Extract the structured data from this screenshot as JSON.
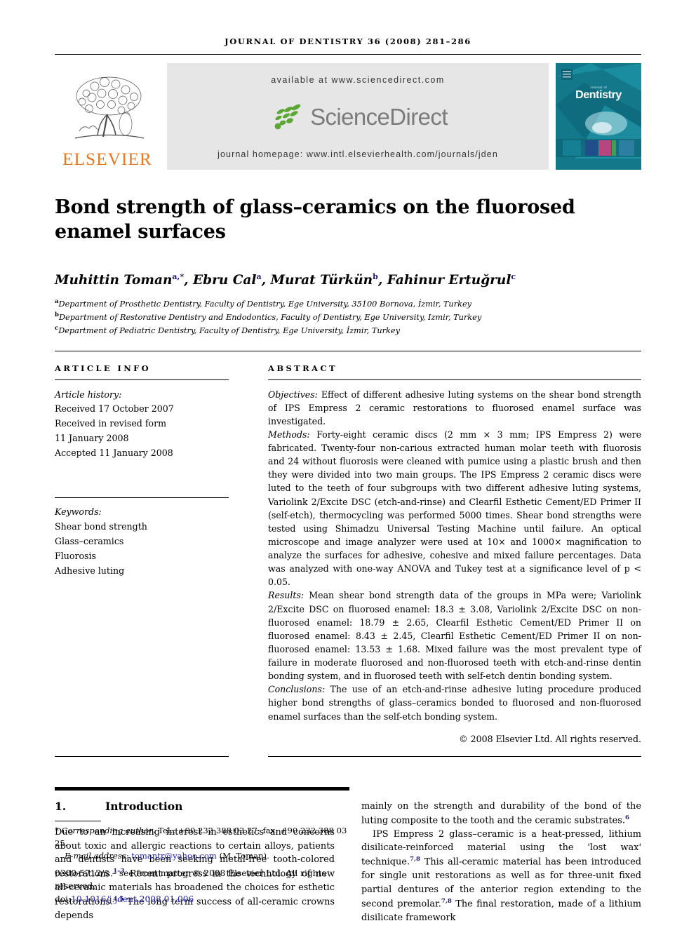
{
  "running_head": "Journal of Dentistry 36 (2008) 281–286",
  "masthead": {
    "elsevier_wordmark": "ELSEVIER",
    "available_at": "available at www.sciencedirect.com",
    "sciencedirect_word": "ScienceDirect",
    "journal_homepage": "journal homepage: www.intl.elsevierhealth.com/journals/jden",
    "cover_title_small": "Journal of",
    "cover_title": "Dentistry",
    "accent_orange": "#E87722",
    "accent_teal": "#13788a",
    "band_gray": "#e6e6e6",
    "sd_green": "#5aa832"
  },
  "article": {
    "title": "Bond strength of glass–ceramics on the fluorosed enamel surfaces",
    "authors": [
      {
        "name": "Muhittin Toman",
        "sup": "a,*"
      },
      {
        "name": "Ebru Cal",
        "sup": "a"
      },
      {
        "name": "Murat Türkün",
        "sup": "b"
      },
      {
        "name": "Fahinur Ertuğrul",
        "sup": "c"
      }
    ],
    "affiliations": [
      {
        "mark": "a",
        "text": "Department of Prosthetic Dentistry, Faculty of Dentistry, Ege University, 35100 Bornova, İzmir, Turkey"
      },
      {
        "mark": "b",
        "text": "Department of Restorative Dentistry and Endodontics, Faculty of Dentistry, Ege University, Izmir, Turkey"
      },
      {
        "mark": "c",
        "text": "Department of Pediatric Dentistry, Faculty of Dentistry, Ege University, İzmir, Turkey"
      }
    ]
  },
  "article_info": {
    "heading": "ARTICLE INFO",
    "history_label": "Article history:",
    "history": [
      "Received 17 October 2007",
      "Received in revised form",
      "11 January 2008",
      "Accepted 11 January 2008"
    ],
    "keywords_label": "Keywords:",
    "keywords": [
      "Shear bond strength",
      "Glass–ceramics",
      "Fluorosis",
      "Adhesive luting"
    ]
  },
  "abstract": {
    "heading": "ABSTRACT",
    "objectives_label": "Objectives:",
    "objectives_text": " Effect of different adhesive luting systems on the shear bond strength of IPS Empress 2 ceramic restorations to fluorosed enamel surface was investigated.",
    "methods_label": "Methods:",
    "methods_text": " Forty-eight ceramic discs (2 mm × 3 mm; IPS Empress 2) were fabricated. Twenty-four non-carious extracted human molar teeth with fluorosis and 24 without fluorosis were cleaned with pumice using a plastic brush and then they were divided into two main groups. The IPS Empress 2 ceramic discs were luted to the teeth of four subgroups with two different adhesive luting systems, Variolink 2/Excite DSC (etch-and-rinse) and Clearfil Esthetic Cement/ED Primer II (self-etch), thermocycling was performed 5000 times. Shear bond strengths were tested using Shimadzu Universal Testing Machine until failure. An optical microscope and image analyzer were used at 10× and 1000× magnification to analyze the surfaces for adhesive, cohesive and mixed failure percentages. Data was analyzed with one-way ANOVA and Tukey test at a significance level of p < 0.05.",
    "results_label": "Results:",
    "results_text": "  Mean shear bond strength data of the groups in MPa were; Variolink 2/Excite DSC on fluorosed enamel: 18.3 ± 3.08, Variolink 2/Excite DSC on non-fluorosed enamel: 18.79 ± 2.65, Clearfil Esthetic Cement/ED Primer II on fluorosed enamel: 8.43 ± 2.45, Clearfil Esthetic Cement/ED Primer II on non-fluorosed enamel: 13.53 ± 1.68. Mixed failure was the most prevalent type of failure in moderate fluorosed and non-fluorosed teeth with etch-and-rinse dentin bonding system, and in fluorosed teeth with self-etch dentin bonding system.",
    "conclusions_label": "Conclusions:",
    "conclusions_text": " The use of an etch-and-rinse adhesive luting procedure produced higher bond strengths of glass–ceramics bonded to fluorosed and non-fluorosed enamel surfaces than the self-etch bonding system.",
    "copyright": "© 2008 Elsevier Ltd. All rights reserved."
  },
  "introduction": {
    "number": "1.",
    "title": "Introduction",
    "left_p1": "Due to an increasing interest in esthetics and concerns about toxic and allergic reactions to certain alloys, patients and dentists have been seeking metal-free tooth-colored restorations.",
    "left_p1_ref1": "1–3",
    "left_p1_b": " Recent progress in the technology of new all-ceramic materials has broadened the choices for esthetic restorations.",
    "left_p1_ref2": "4,5",
    "left_p1_c": " The long term success of all-ceramic crowns depends",
    "right_p1": "mainly on the strength and durability of the bond of the luting composite to the tooth and the ceramic substrates.",
    "right_p1_ref": "6",
    "right_p2_a": "IPS Empress 2 glass–ceramic is a heat-pressed, lithium disilicate-reinforced material using the 'lost wax' technique.",
    "right_p2_ref1": "7,8",
    "right_p2_b": " This all-ceramic material has been introduced for single unit restorations as well as for three-unit fixed partial dentures of the anterior region extending to the second premolar.",
    "right_p2_ref2": "7,8",
    "right_p2_c": " The final restoration, made of a lithium disilicate framework"
  },
  "footer": {
    "corresponding_marker": "*",
    "corresponding_label": "Corresponding author",
    "corresponding_contact": ". Tel.: +90 232 388 03 27; fax: +90 232 388 03 25.",
    "email_label": "E-mail address:",
    "email": "tomantr@yahoo.com",
    "email_owner": "(M. Toman).",
    "issn_line": "0300-5712/$ – see front matter © 2008 Elsevier Ltd. All rights reserved.",
    "doi_label": "doi:",
    "doi": "10.1016/j.jdent.2008.01.006"
  }
}
